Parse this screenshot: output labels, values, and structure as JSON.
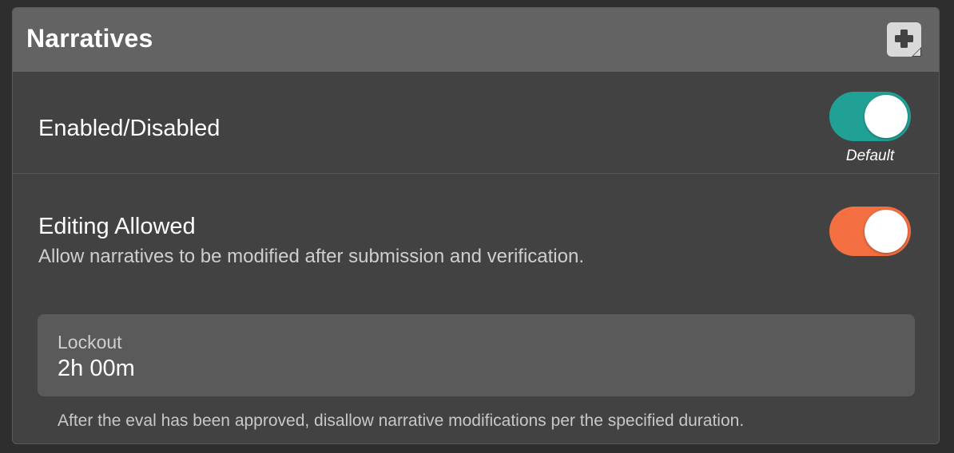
{
  "panel": {
    "title": "Narratives",
    "add_note_icon": "note-add-icon"
  },
  "settings": {
    "enabled": {
      "label": "Enabled/Disabled",
      "state": "on",
      "hint": "Default",
      "color": "#21a196"
    },
    "editing": {
      "label": "Editing Allowed",
      "description": "Allow narratives to be modified after submission and verification.",
      "state": "on",
      "color": "#f46f41"
    },
    "lockout": {
      "label": "Lockout",
      "value": "2h 00m",
      "help": "After the eval has been approved, disallow narrative modifications per the specified duration."
    }
  }
}
